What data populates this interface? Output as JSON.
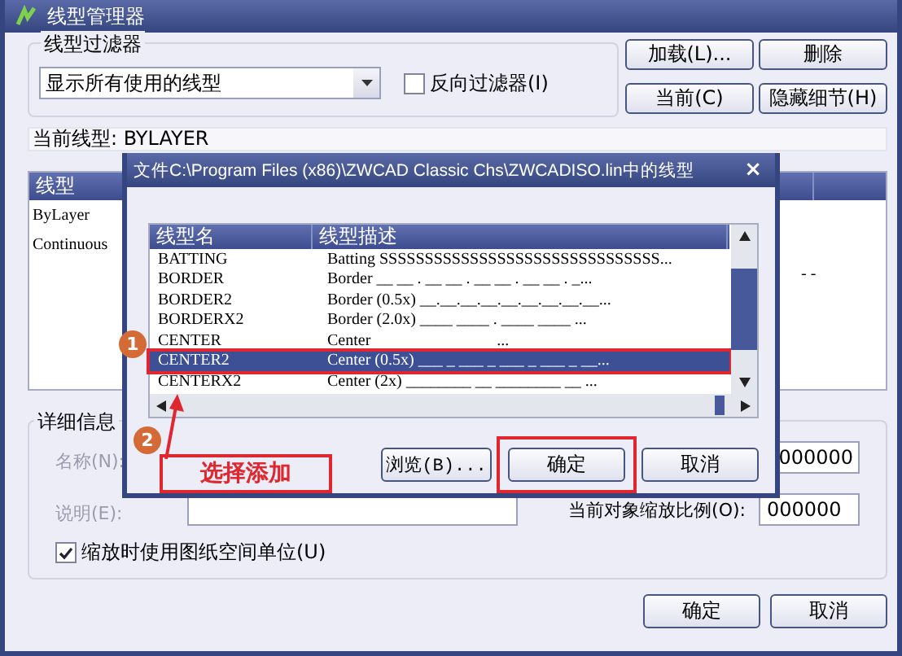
{
  "window": {
    "title": "线型管理器"
  },
  "filter": {
    "legend": "线型过滤器",
    "dropdown": "显示所有使用的线型",
    "invert": {
      "label": "反向过滤器(I)",
      "checked": false
    }
  },
  "top_buttons": [
    "加载(L)...",
    "删除",
    "当前(C)",
    "隐藏细节(H)"
  ],
  "current_linetype": "当前线型: BYLAYER",
  "list": {
    "columns": [
      "线型"
    ],
    "rows": [
      "ByLayer",
      "Continuous"
    ],
    "row_3_column_3": "- -"
  },
  "details": {
    "legend": "详细信息",
    "fields": [
      {
        "label": "名称(N):",
        "disabled": true
      },
      {
        "label": "说明(E):",
        "disabled": true
      }
    ],
    "scale_label": "当前对象缩放比例(O):",
    "scale_values": [
      "000000",
      "000000"
    ],
    "paper_space": {
      "label": "缩放时使用图纸空间单位(U)",
      "checked": true
    }
  },
  "bottom_buttons": [
    "确定",
    "取消"
  ],
  "dialog": {
    "title": "文件C:\\Program Files (x86)\\ZWCAD Classic Chs\\ZWCADISO.lin中的线型",
    "close": "×",
    "columns": [
      "线型名",
      "线型描述"
    ],
    "rows": [
      {
        "name": "BATTING",
        "description": "Batting SSSSSSSSSSSSSSSSSSSSSSSSSSSSSSS...",
        "selected": false,
        "highlighted": false
      },
      {
        "name": "BORDER",
        "description": "Border __ __ . __ __ . __ __ . __ __ . _...",
        "selected": false,
        "highlighted": false
      },
      {
        "name": "BORDER2",
        "description": "Border (0.5x) __.__.__.__.__.__.__.__.__...",
        "selected": false,
        "highlighted": false
      },
      {
        "name": "BORDERX2",
        "description": "Border (2.0x) ____ ____ . ____ ____ ...",
        "selected": false,
        "highlighted": false
      },
      {
        "name": "CENTER",
        "description": "Center                               ...",
        "selected": false,
        "highlighted": false
      },
      {
        "name": "CENTER2",
        "description": "Center (0.5x) ___ _ ___ _ ___ _ ___ _ __...",
        "selected": true,
        "highlighted": true
      },
      {
        "name": "CENTERX2",
        "description": "Center (2x) ________ __ ________ __ ...",
        "selected": false,
        "highlighted": false
      }
    ],
    "buttons": [
      {
        "label": "浏览(B)...",
        "highlighted": false
      },
      {
        "label": "确定",
        "highlighted": true
      },
      {
        "label": "取消",
        "highlighted": false
      }
    ]
  },
  "annotations": [
    {
      "number": "1"
    },
    {
      "number": "2",
      "label": "选择添加"
    }
  ]
}
